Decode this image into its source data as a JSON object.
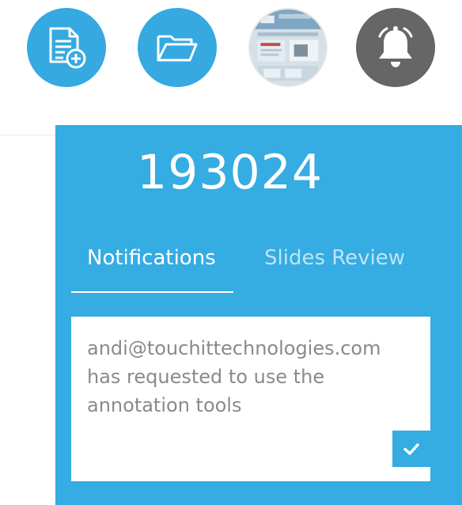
{
  "toolbar": {
    "new_document_icon": "document-add-icon",
    "open_folder_icon": "folder-icon",
    "presentation_thumbnail": "presentation-thumbnail",
    "notifications_icon": "bell-icon"
  },
  "panel": {
    "session_number": "193024",
    "tabs": [
      {
        "label": "Notifications",
        "active": true
      },
      {
        "label": "Slides Review",
        "active": false
      }
    ],
    "notification": {
      "message": "andi@touchittechnologies.com has requested to use the annotation tools",
      "approve_icon": "checkmark-icon"
    }
  },
  "colors": {
    "accent": "#35ace2",
    "bell_background": "#666666",
    "card_text": "#8a8a8a",
    "inactive_tab": "#bfe4f6"
  }
}
